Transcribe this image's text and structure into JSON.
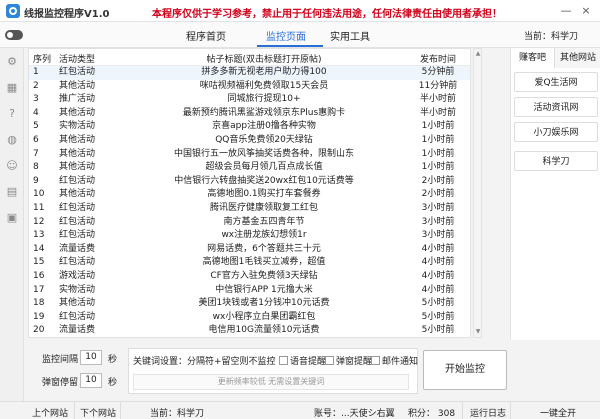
{
  "window": {
    "title": "线报监控程序V1.0",
    "disclaimer": "本程序仅供于学习参考，禁止用于任何违法用途，任何法律责任由使用者承担！",
    "minimize_glyph": "—",
    "close_glyph": "×"
  },
  "nav": {
    "tabs": [
      "程序首页",
      "监控页面",
      "实用工具"
    ],
    "current_site": "当前：科学刀"
  },
  "table": {
    "headers": [
      "序列",
      "活动类型",
      "帖子标题(双击标题打开原帖)",
      "发布时间"
    ],
    "rows": [
      {
        "seq": "1",
        "type": "红包活动",
        "title": "拼多多新无视老用户助力得100",
        "time": "5分钟前"
      },
      {
        "seq": "2",
        "type": "其他活动",
        "title": "咪咕视频福利免费领取15天会员",
        "time": "11分钟前"
      },
      {
        "seq": "3",
        "type": "推广活动",
        "title": "同城旅行提现10+",
        "time": "半小时前"
      },
      {
        "seq": "4",
        "type": "其他活动",
        "title": "最新预约腾讯黑鲨游戏领京东Plus惠购卡",
        "time": "半小时前"
      },
      {
        "seq": "5",
        "type": "实物活动",
        "title": "京喜app注册0撸各种实物",
        "time": "1小时前"
      },
      {
        "seq": "6",
        "type": "其他活动",
        "title": "QQ音乐免费领20天绿钻",
        "time": "1小时前"
      },
      {
        "seq": "7",
        "type": "其他活动",
        "title": "中国银行五一放风筝抽奖话费各种，限制山东",
        "time": "1小时前"
      },
      {
        "seq": "8",
        "type": "其他活动",
        "title": "超级会员每月领几百点成长值",
        "time": "1小时前"
      },
      {
        "seq": "9",
        "type": "红包活动",
        "title": "中信银行六转盘抽奖送20wx红包10元话费等",
        "time": "2小时前"
      },
      {
        "seq": "10",
        "type": "其他活动",
        "title": "高德地图0.1购买打车套餐券",
        "time": "2小时前"
      },
      {
        "seq": "11",
        "type": "红包活动",
        "title": "腾讯医疗健康领取复工红包",
        "time": "3小时前"
      },
      {
        "seq": "12",
        "type": "红包活动",
        "title": "南方基金五四青年节",
        "time": "3小时前"
      },
      {
        "seq": "13",
        "type": "红包活动",
        "title": "wx注册龙族幻想领1r",
        "time": "3小时前"
      },
      {
        "seq": "14",
        "type": "流量话费",
        "title": "网易话费，6个答题共三十元",
        "time": "4小时前"
      },
      {
        "seq": "15",
        "type": "红包活动",
        "title": "高德地图1毛钱买立减券，超值",
        "time": "4小时前"
      },
      {
        "seq": "16",
        "type": "游戏活动",
        "title": "CF官方入驻免费领3天绿钻",
        "time": "4小时前"
      },
      {
        "seq": "17",
        "type": "实物活动",
        "title": "中信银行APP 1元撸大米",
        "time": "4小时前"
      },
      {
        "seq": "18",
        "type": "其他活动",
        "title": "美团1块钱或者1分钱冲10元话费",
        "time": "5小时前"
      },
      {
        "seq": "19",
        "type": "红包活动",
        "title": "wx小程序立白果团霸红包",
        "time": "5小时前"
      },
      {
        "seq": "20",
        "type": "流量话费",
        "title": "电信用10G流量领10元话费",
        "time": "5小时前"
      }
    ]
  },
  "right_panel": {
    "tabs": [
      "赚客吧",
      "其他网站"
    ],
    "sites": [
      "爱Q生活网",
      "活动资讯网",
      "小刀娱乐网",
      "科学刀"
    ]
  },
  "controls": {
    "interval_label": "监控间隔",
    "interval_value": "10",
    "pause_label": "弹窗停留",
    "pause_value": "10",
    "seconds": "秒",
    "keyword_label": "关键词设置：分隔符+留空则不监控",
    "checkboxes": [
      "语音提醒",
      "弹窗提醒",
      "邮件通知"
    ],
    "keyword_placeholder": "更新频率较低 无需设置关键词",
    "start_button": "开始监控"
  },
  "status": {
    "prev_site": "上个网站",
    "next_site": "下个网站",
    "current": "当前：科学刀",
    "account": "账号：...天使シ右翼",
    "points": "积分：  308",
    "runtime": "运行日志",
    "finish": "一键全开"
  }
}
